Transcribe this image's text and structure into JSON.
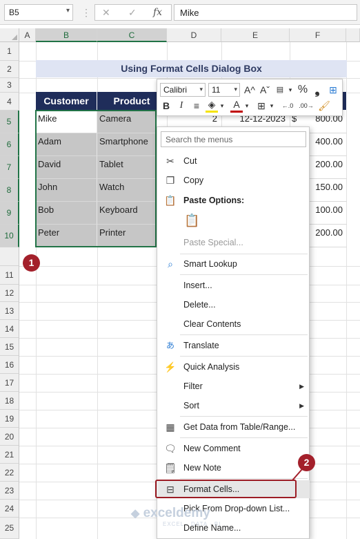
{
  "formula_bar": {
    "name_box": "B5",
    "cancel_icon": "✕",
    "enter_icon": "✓",
    "fx_label": "fx",
    "content": "Mike"
  },
  "sheet": {
    "columns": [
      "A",
      "B",
      "C",
      "D",
      "E",
      "F"
    ],
    "rows": [
      "1",
      "2",
      "3",
      "4",
      "5",
      "6",
      "7",
      "8",
      "9",
      "10",
      "11",
      "12",
      "13",
      "14",
      "15",
      "16",
      "17",
      "18",
      "19",
      "20",
      "21",
      "22",
      "23",
      "24",
      "25"
    ],
    "title": "Using Format Cells Dialog Box",
    "headers": {
      "customer": "Customer",
      "product": "Product"
    },
    "data_rows": [
      {
        "customer": "Mike",
        "product": "Camera",
        "qty": "2",
        "date": "12-12-2023",
        "currency": "$",
        "price": "800.00"
      },
      {
        "customer": "Adam",
        "product": "Smartphone",
        "price": "400.00"
      },
      {
        "customer": "David",
        "product": "Tablet",
        "price": "200.00"
      },
      {
        "customer": "John",
        "product": "Watch",
        "price": "150.00"
      },
      {
        "customer": "Bob",
        "product": "Keyboard",
        "price": "100.00"
      },
      {
        "customer": "Peter",
        "product": "Printer",
        "price": "200.00"
      }
    ]
  },
  "mini_toolbar": {
    "font": "Calibri",
    "size": "11",
    "grow_font": "A^",
    "shrink_font": "Aˇ",
    "percent": "%",
    "comma": "❟",
    "bold": "B",
    "italic": "I",
    "font_color": "A",
    "dec_increase": "←.0",
    "dec_decrease": ".00→"
  },
  "context_menu": {
    "search_placeholder": "Search the menus",
    "cut": "Cut",
    "copy": "Copy",
    "paste_options": "Paste Options:",
    "paste_special": "Paste Special...",
    "smart_lookup": "Smart Lookup",
    "insert": "Insert...",
    "delete": "Delete...",
    "clear_contents": "Clear Contents",
    "translate": "Translate",
    "quick_analysis": "Quick Analysis",
    "filter": "Filter",
    "sort": "Sort",
    "get_data": "Get Data from Table/Range...",
    "new_comment": "New Comment",
    "new_note": "New Note",
    "format_cells": "Format Cells...",
    "pick_dropdown": "Pick From Drop-down List...",
    "define_name": "Define Name..."
  },
  "annotations": {
    "step1": "1",
    "step2": "2"
  },
  "watermark": {
    "name": "exceldemy",
    "tagline": "EXCEL · DATA · BI"
  },
  "colors": {
    "header_fill": "#1f2d5a",
    "title_fill": "#dfe4f3",
    "selection_border": "#217346",
    "callout": "#a3202b"
  }
}
